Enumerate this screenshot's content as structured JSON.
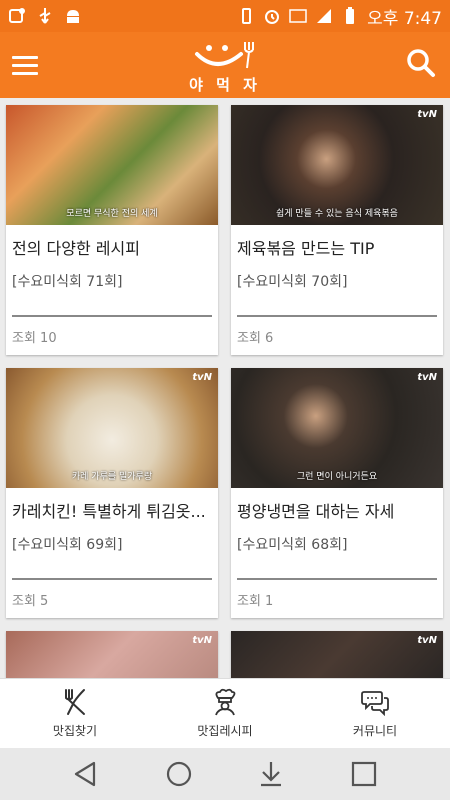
{
  "status_bar": {
    "left_icons": [
      "notification-icon",
      "usb-icon",
      "android-debug-icon"
    ],
    "right_icons": [
      "vibrate-icon",
      "alarm-icon",
      "lte-icon",
      "signal-icon",
      "battery-icon"
    ],
    "time": "오후 7:47"
  },
  "app_bar": {
    "logo_text": "야 먹 자",
    "accent_color": "#f47b20"
  },
  "cards": [
    {
      "title": "전의 다양한 레시피",
      "episode": "[수요미식회 71회]",
      "views": "조회 10",
      "caption": "모르면 무식한 전의 세계",
      "thumb_color": "#b96a3a"
    },
    {
      "title": "제육볶음 만드는 TIP",
      "episode": "[수요미식회 70회]",
      "views": "조회 6",
      "caption": "쉽게 만들 수 있는 음식 제육볶음",
      "thumb_color": "#2f2a24"
    },
    {
      "title": "카레치킨! 특별하게 튀김옷...",
      "episode": "[수요미식회 69회]",
      "views": "조회 5",
      "caption": "카레 가루를 밀가루랑",
      "thumb_color": "#c9a97a"
    },
    {
      "title": "평양냉면을 대하는 자세",
      "episode": "[수요미식회 68회]",
      "views": "조회 1",
      "caption": "그런 면이 아니거든요",
      "thumb_color": "#2d2a28"
    },
    {
      "thumb_color": "#b9877a"
    },
    {
      "thumb_color": "#2a2624"
    }
  ],
  "bottom_nav": {
    "items": [
      {
        "label": "맛집찾기",
        "icon": "fork-knife-icon"
      },
      {
        "label": "맛집레시피",
        "icon": "chef-icon"
      },
      {
        "label": "커뮤니티",
        "icon": "chat-bubbles-icon"
      }
    ]
  },
  "system_nav": [
    "back-icon",
    "home-icon",
    "download-icon",
    "recents-icon"
  ]
}
